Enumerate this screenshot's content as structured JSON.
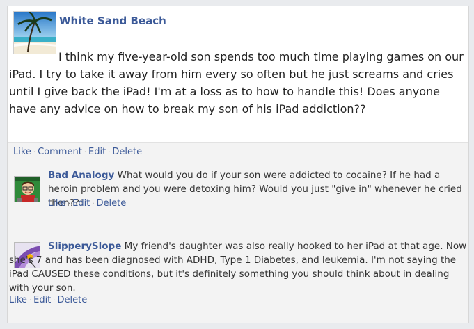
{
  "post": {
    "author": "White Sand Beach",
    "avatar_icon": "beach-palm-photo",
    "text": "I think my five-year-old son spends too much time playing games on our iPad. I try to take it away from him every so often but he just screams and cries until I give back the iPad! I'm at a loss as to how to handle this! Does anyone have any advice on how to break my son of his iPad addiction??",
    "actions": {
      "like": "Like",
      "comment": "Comment",
      "edit": "Edit",
      "delete": "Delete",
      "separator": "·"
    }
  },
  "comments": [
    {
      "author": "Bad Analogy",
      "avatar_icon": "cartoon-guy-avatar",
      "text": "What would you do if your son were addicted to cocaine? If he had a heroin problem and you were detoxing him? Would you just \"give in\" whenever he cried then??!",
      "actions": {
        "like": "Like",
        "edit": "Edit",
        "delete": "Delete",
        "separator": "·"
      }
    },
    {
      "author": "SlipperySlope",
      "avatar_icon": "purple-slide-avatar",
      "text": "My friend's daughter was also really hooked to her iPad at that age. Now she's 7 and has been diagnosed with ADHD, Type 1 Diabetes, and leukemia. I'm not saying the iPad CAUSED these conditions, but it's definitely something you should think about in dealing with your son.",
      "actions": {
        "like": "Like",
        "edit": "Edit",
        "delete": "Delete",
        "separator": "·"
      }
    }
  ],
  "colors": {
    "link": "#3b5998",
    "background": "#e9ebee",
    "card": "#f3f3f3",
    "post": "#ffffff"
  }
}
